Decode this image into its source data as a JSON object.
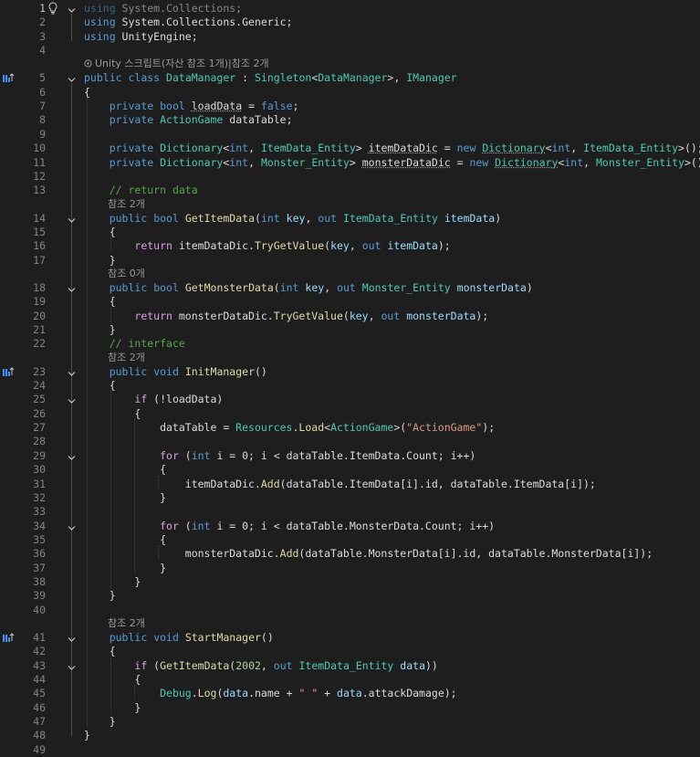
{
  "editor": {
    "current_line": 1,
    "line_numbers": [
      "1",
      "2",
      "3",
      "4",
      "5",
      "6",
      "7",
      "8",
      "9",
      "10",
      "11",
      "12",
      "13",
      "14",
      "15",
      "16",
      "17",
      "18",
      "19",
      "20",
      "21",
      "22",
      "23",
      "24",
      "25",
      "26",
      "27",
      "28",
      "29",
      "30",
      "31",
      "32",
      "33",
      "34",
      "35",
      "36",
      "37",
      "38",
      "39",
      "40",
      "41",
      "42",
      "43",
      "44",
      "45",
      "46",
      "47",
      "48",
      "49"
    ],
    "codelens": {
      "l5": "Unity 스크립트(자산 참조 1개)|참조 2개",
      "l14": "참조 2개",
      "l18": "참조 0개",
      "l23": "참조 2개",
      "l41": "참조 2개"
    },
    "code": {
      "l1": [
        [
          "using",
          "kw dim"
        ],
        [
          " System.Collections;",
          "fd dim"
        ]
      ],
      "l2": [
        [
          "using",
          "kw"
        ],
        [
          " System.Collections.Generic;",
          "fd"
        ]
      ],
      "l3": [
        [
          "using",
          "kw"
        ],
        [
          " UnityEngine;",
          "fd"
        ]
      ],
      "l5": [
        [
          "public",
          "kw"
        ],
        [
          " ",
          ""
        ],
        [
          "class",
          "kw"
        ],
        [
          " ",
          ""
        ],
        [
          "DataManager",
          "ty"
        ],
        [
          " : ",
          ""
        ],
        [
          "Singleton",
          "ty"
        ],
        [
          "<",
          ""
        ],
        [
          "DataManager",
          "ty"
        ],
        [
          ">, ",
          ""
        ],
        [
          "IManager",
          "ty"
        ]
      ],
      "l6": [
        [
          "{",
          ""
        ]
      ],
      "l7": [
        [
          "    ",
          ""
        ],
        [
          "private",
          "kw"
        ],
        [
          " ",
          ""
        ],
        [
          "bool",
          "kw"
        ],
        [
          " ",
          ""
        ],
        [
          "loadData",
          "uline"
        ],
        [
          " = ",
          ""
        ],
        [
          "false",
          "kw"
        ],
        [
          ";",
          ""
        ]
      ],
      "l8": [
        [
          "    ",
          ""
        ],
        [
          "private",
          "kw"
        ],
        [
          " ",
          ""
        ],
        [
          "ActionGame",
          "ty"
        ],
        [
          " dataTable;",
          ""
        ]
      ],
      "l10": [
        [
          "    ",
          ""
        ],
        [
          "private",
          "kw"
        ],
        [
          " ",
          ""
        ],
        [
          "Dictionary",
          "ty"
        ],
        [
          "<",
          ""
        ],
        [
          "int",
          "kw"
        ],
        [
          ", ",
          ""
        ],
        [
          "ItemData_Entity",
          "ty"
        ],
        [
          "> ",
          ""
        ],
        [
          "itemDataDic",
          "uline"
        ],
        [
          " = ",
          ""
        ],
        [
          "new",
          "kw"
        ],
        [
          " ",
          ""
        ],
        [
          "Dictionary",
          "ty uline"
        ],
        [
          "<",
          ""
        ],
        [
          "int",
          "kw"
        ],
        [
          ", ",
          ""
        ],
        [
          "ItemData_Entity",
          "ty"
        ],
        [
          ">();",
          ""
        ]
      ],
      "l11": [
        [
          "    ",
          ""
        ],
        [
          "private",
          "kw"
        ],
        [
          " ",
          ""
        ],
        [
          "Dictionary",
          "ty"
        ],
        [
          "<",
          ""
        ],
        [
          "int",
          "kw"
        ],
        [
          ", ",
          ""
        ],
        [
          "Monster_Entity",
          "ty"
        ],
        [
          "> ",
          ""
        ],
        [
          "monsterDataDic",
          "uline"
        ],
        [
          " = ",
          ""
        ],
        [
          "new",
          "kw"
        ],
        [
          " ",
          ""
        ],
        [
          "Dictionary",
          "ty uline"
        ],
        [
          "<",
          ""
        ],
        [
          "int",
          "kw"
        ],
        [
          ", ",
          ""
        ],
        [
          "Monster_Entity",
          "ty"
        ],
        [
          ">();",
          ""
        ]
      ],
      "l13": [
        [
          "    ",
          ""
        ],
        [
          "// return data",
          "cm"
        ]
      ],
      "l14": [
        [
          "    ",
          ""
        ],
        [
          "public",
          "kw"
        ],
        [
          " ",
          ""
        ],
        [
          "bool",
          "kw"
        ],
        [
          " ",
          ""
        ],
        [
          "GetItemData",
          "fn"
        ],
        [
          "(",
          ""
        ],
        [
          "int",
          "kw"
        ],
        [
          " ",
          ""
        ],
        [
          "key",
          "pm"
        ],
        [
          ", ",
          ""
        ],
        [
          "out",
          "kw"
        ],
        [
          " ",
          ""
        ],
        [
          "ItemData_Entity",
          "ty"
        ],
        [
          " ",
          ""
        ],
        [
          "itemData",
          "pm"
        ],
        [
          ")",
          ""
        ]
      ],
      "l15": [
        [
          "    {",
          ""
        ]
      ],
      "l16": [
        [
          "        ",
          ""
        ],
        [
          "return",
          "ctl"
        ],
        [
          " itemDataDic.",
          ""
        ],
        [
          "TryGetValue",
          "fn"
        ],
        [
          "(",
          ""
        ],
        [
          "key",
          "pm"
        ],
        [
          ", ",
          ""
        ],
        [
          "out",
          "kw"
        ],
        [
          " ",
          ""
        ],
        [
          "itemData",
          "pm"
        ],
        [
          ");",
          ""
        ]
      ],
      "l17": [
        [
          "    }",
          ""
        ]
      ],
      "l18": [
        [
          "    ",
          ""
        ],
        [
          "public",
          "kw"
        ],
        [
          " ",
          ""
        ],
        [
          "bool",
          "kw"
        ],
        [
          " ",
          ""
        ],
        [
          "GetMonsterData",
          "fn"
        ],
        [
          "(",
          ""
        ],
        [
          "int",
          "kw"
        ],
        [
          " ",
          ""
        ],
        [
          "key",
          "pm"
        ],
        [
          ", ",
          ""
        ],
        [
          "out",
          "kw"
        ],
        [
          " ",
          ""
        ],
        [
          "Monster_Entity",
          "ty"
        ],
        [
          " ",
          ""
        ],
        [
          "monsterData",
          "pm"
        ],
        [
          ")",
          ""
        ]
      ],
      "l19": [
        [
          "    {",
          ""
        ]
      ],
      "l20": [
        [
          "        ",
          ""
        ],
        [
          "return",
          "ctl"
        ],
        [
          " monsterDataDic.",
          ""
        ],
        [
          "TryGetValue",
          "fn"
        ],
        [
          "(",
          ""
        ],
        [
          "key",
          "pm"
        ],
        [
          ", ",
          ""
        ],
        [
          "out",
          "kw"
        ],
        [
          " ",
          ""
        ],
        [
          "monsterData",
          "pm"
        ],
        [
          ");",
          ""
        ]
      ],
      "l21": [
        [
          "    }",
          ""
        ]
      ],
      "l22": [
        [
          "    ",
          ""
        ],
        [
          "// interface",
          "cm"
        ]
      ],
      "l23": [
        [
          "    ",
          ""
        ],
        [
          "public",
          "kw"
        ],
        [
          " ",
          ""
        ],
        [
          "void",
          "kw"
        ],
        [
          " ",
          ""
        ],
        [
          "InitManager",
          "fn"
        ],
        [
          "()",
          ""
        ]
      ],
      "l24": [
        [
          "    {",
          ""
        ]
      ],
      "l25": [
        [
          "        ",
          ""
        ],
        [
          "if",
          "ctl"
        ],
        [
          " (!loadData)",
          ""
        ]
      ],
      "l26": [
        [
          "        {",
          ""
        ]
      ],
      "l27": [
        [
          "            dataTable = ",
          ""
        ],
        [
          "Resources",
          "ty"
        ],
        [
          ".",
          ""
        ],
        [
          "Load",
          "fn"
        ],
        [
          "<",
          ""
        ],
        [
          "ActionGame",
          "ty"
        ],
        [
          ">(",
          ""
        ],
        [
          "\"ActionGame\"",
          "st"
        ],
        [
          ");",
          ""
        ]
      ],
      "l29": [
        [
          "            ",
          ""
        ],
        [
          "for",
          "ctl"
        ],
        [
          " (",
          ""
        ],
        [
          "int",
          "kw"
        ],
        [
          " i = 0; i < dataTable.ItemData.Count; i++)",
          ""
        ]
      ],
      "l30": [
        [
          "            {",
          ""
        ]
      ],
      "l31": [
        [
          "                itemDataDic.",
          ""
        ],
        [
          "Add",
          "fn"
        ],
        [
          "(dataTable.ItemData[i].id, dataTable.ItemData[i]);",
          ""
        ]
      ],
      "l32": [
        [
          "            }",
          ""
        ]
      ],
      "l34": [
        [
          "            ",
          ""
        ],
        [
          "for",
          "ctl"
        ],
        [
          " (",
          ""
        ],
        [
          "int",
          "kw"
        ],
        [
          " i = 0; i < dataTable.MonsterData.Count; i++)",
          ""
        ]
      ],
      "l35": [
        [
          "            {",
          ""
        ]
      ],
      "l36": [
        [
          "                monsterDataDic.",
          ""
        ],
        [
          "Add",
          "fn"
        ],
        [
          "(dataTable.MonsterData[i].id, dataTable.MonsterData[i]);",
          ""
        ]
      ],
      "l37": [
        [
          "            }",
          ""
        ]
      ],
      "l38": [
        [
          "        }",
          ""
        ]
      ],
      "l39": [
        [
          "    }",
          ""
        ]
      ],
      "l41": [
        [
          "    ",
          ""
        ],
        [
          "public",
          "kw"
        ],
        [
          " ",
          ""
        ],
        [
          "void",
          "kw"
        ],
        [
          " ",
          ""
        ],
        [
          "StartManager",
          "fn"
        ],
        [
          "()",
          ""
        ]
      ],
      "l42": [
        [
          "    {",
          ""
        ]
      ],
      "l43": [
        [
          "        ",
          ""
        ],
        [
          "if",
          "ctl"
        ],
        [
          " (",
          ""
        ],
        [
          "GetItemData",
          "fn"
        ],
        [
          "(",
          ""
        ],
        [
          "2002",
          "nm"
        ],
        [
          ", ",
          ""
        ],
        [
          "out",
          "kw"
        ],
        [
          " ",
          ""
        ],
        [
          "ItemData_Entity",
          "ty"
        ],
        [
          " ",
          ""
        ],
        [
          "data",
          "pm"
        ],
        [
          "))",
          ""
        ]
      ],
      "l44": [
        [
          "        {",
          ""
        ]
      ],
      "l45": [
        [
          "            ",
          ""
        ],
        [
          "Debug",
          "ty"
        ],
        [
          ".",
          ""
        ],
        [
          "Log",
          "fn"
        ],
        [
          "(",
          ""
        ],
        [
          "data",
          "pm"
        ],
        [
          ".name + ",
          ""
        ],
        [
          "\" \"",
          "st"
        ],
        [
          " + ",
          ""
        ],
        [
          "data",
          "pm"
        ],
        [
          ".attackDamage);",
          ""
        ]
      ],
      "l46": [
        [
          "        }",
          ""
        ]
      ],
      "l47": [
        [
          "    }",
          ""
        ]
      ],
      "l48": [
        [
          "}",
          ""
        ]
      ]
    },
    "colors": {
      "background": "#1e1e1e",
      "keyword": "#569cd6",
      "type": "#4ec9b0",
      "method": "#dcdcaa",
      "parameter": "#9cdcfe",
      "string": "#d69d85",
      "comment": "#57a64a",
      "control": "#d8a0df"
    },
    "icons": {
      "l1": "lightbulb-icon",
      "l5": "implementation-glyph-icon",
      "l23": "implementation-glyph-icon",
      "l41": "implementation-glyph-icon"
    }
  }
}
